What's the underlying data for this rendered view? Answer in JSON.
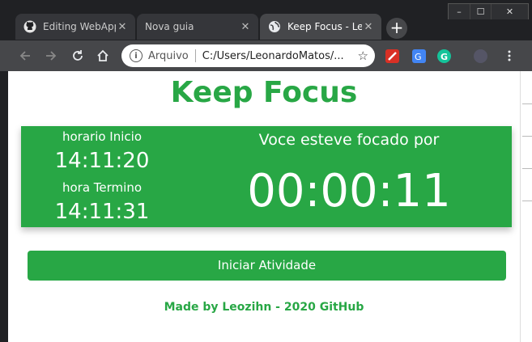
{
  "browser": {
    "tabs": [
      {
        "title": "Editing WebApp",
        "icon": "github-icon"
      },
      {
        "title": "Nova guia",
        "icon": ""
      },
      {
        "title": "Keep Focus - Le",
        "icon": "globe-icon"
      }
    ],
    "close_glyph": "✕",
    "new_tab_glyph": "+",
    "omnibox": {
      "scheme_label": "Arquivo",
      "url": "C:/Users/LeonardoMatos/..."
    },
    "window_controls": {
      "minimize": "–",
      "maximize": "☐",
      "close": "✕"
    }
  },
  "app": {
    "title": "Keep Focus",
    "start_label": "horario Inicio",
    "start_time": "14:11:20",
    "end_label": "hora Termino",
    "end_time": "14:11:31",
    "focus_label": "Voce esteve focado por",
    "focus_timer": "00:00:11",
    "start_button": "Iniciar Atividade",
    "footer": "Made by Leozihn - 2020 GitHub"
  },
  "colors": {
    "accent": "#28a745",
    "chrome_dark": "#202124",
    "chrome_tab": "#35363a",
    "chrome_active": "#46474a"
  }
}
